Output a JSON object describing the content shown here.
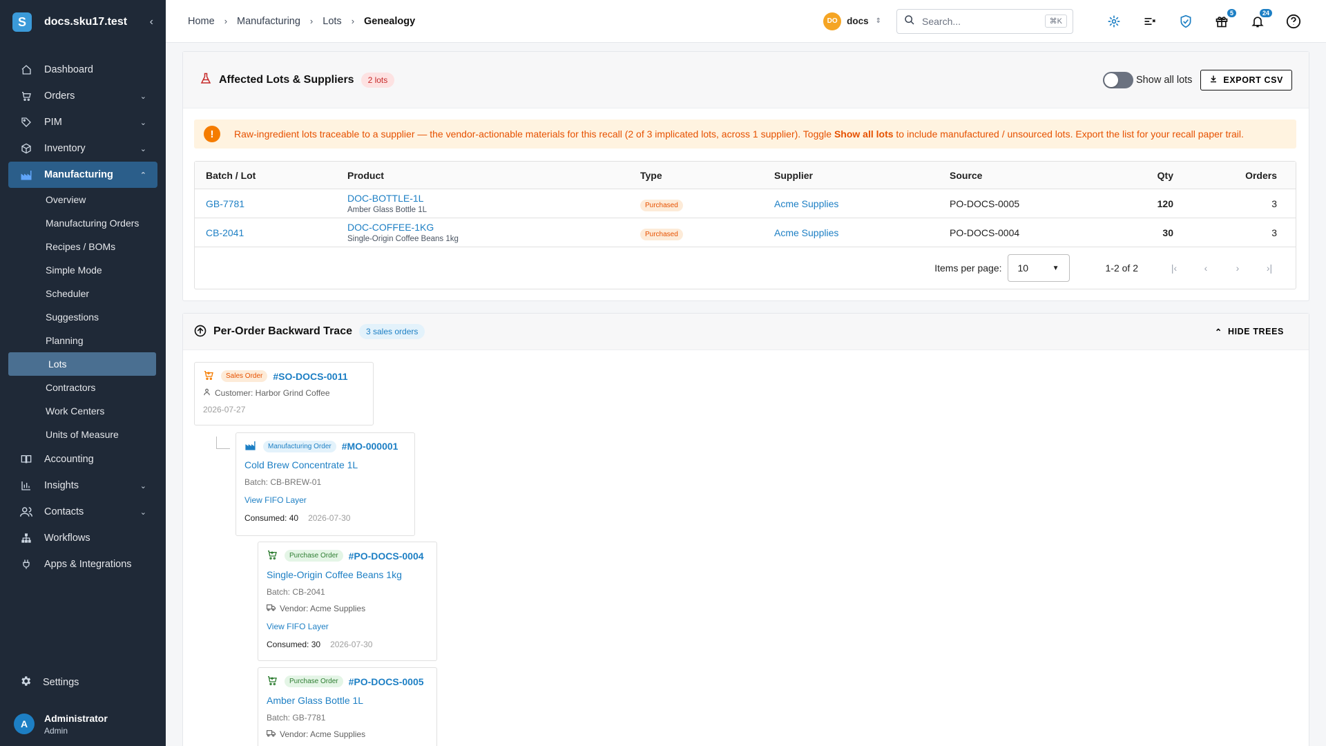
{
  "app": {
    "workspace": "docs.sku17.test",
    "logo_letter": "S"
  },
  "nav": {
    "items": [
      {
        "label": "Dashboard",
        "icon": "home-icon"
      },
      {
        "label": "Orders",
        "icon": "cart-icon",
        "expandable": true
      },
      {
        "label": "PIM",
        "icon": "tag-icon",
        "expandable": true
      },
      {
        "label": "Inventory",
        "icon": "box-icon",
        "expandable": true
      },
      {
        "label": "Manufacturing",
        "icon": "factory-icon",
        "expandable": true,
        "active": true
      }
    ],
    "manufacturing_sub": [
      "Overview",
      "Manufacturing Orders",
      "Recipes / BOMs",
      "Simple Mode",
      "Scheduler",
      "Suggestions",
      "Planning",
      "Lots",
      "Contractors",
      "Work Centers",
      "Units of Measure"
    ],
    "active_sub": "Lots",
    "items_after": [
      {
        "label": "Accounting",
        "icon": "book-icon"
      },
      {
        "label": "Insights",
        "icon": "chart-icon",
        "expandable": true
      },
      {
        "label": "Contacts",
        "icon": "contacts-icon",
        "expandable": true
      },
      {
        "label": "Workflows",
        "icon": "workflow-icon"
      },
      {
        "label": "Apps & Integrations",
        "icon": "plug-icon"
      }
    ],
    "settings": "Settings",
    "user": {
      "initial": "A",
      "name": "Administrator",
      "role": "Admin"
    }
  },
  "topbar": {
    "breadcrumbs": [
      "Home",
      "Manufacturing",
      "Lots",
      "Genealogy"
    ],
    "org_initials": "DO",
    "org_name": "docs",
    "search_placeholder": "Search...",
    "search_shortcut": "⌘K",
    "gift_badge": "5",
    "notif_badge": "24"
  },
  "affected": {
    "title": "Affected Lots & Suppliers",
    "count_pill": "2 lots",
    "toggle_label": "Show all lots",
    "export_label": "EXPORT CSV",
    "alert_pre": "Raw-ingredient lots traceable to a supplier — the vendor-actionable materials for this recall (2 of 3 implicated lots, across 1 supplier). Toggle ",
    "alert_bold": "Show all lots",
    "alert_post": " to include manufactured / unsourced lots. Export the list for your recall paper trail.",
    "columns": [
      "Batch / Lot",
      "Product",
      "Type",
      "Supplier",
      "Source",
      "Qty",
      "Orders"
    ],
    "rows": [
      {
        "lot": "GB-7781",
        "code": "DOC-BOTTLE-1L",
        "name": "Amber Glass Bottle 1L",
        "type": "Purchased",
        "supplier": "Acme Supplies",
        "source": "PO-DOCS-0005",
        "qty": "120",
        "orders": "3"
      },
      {
        "lot": "CB-2041",
        "code": "DOC-COFFEE-1KG",
        "name": "Single-Origin Coffee Beans 1kg",
        "type": "Purchased",
        "supplier": "Acme Supplies",
        "source": "PO-DOCS-0004",
        "qty": "30",
        "orders": "3"
      }
    ],
    "items_per_page_label": "Items per page:",
    "items_per_page": "10",
    "range": "1-2 of 2"
  },
  "trace": {
    "title": "Per-Order Backward Trace",
    "count_pill": "3 sales orders",
    "hide_label": "HIDE TREES",
    "sales": {
      "tag": "Sales Order",
      "id": "#SO-DOCS-0011",
      "customer": "Customer: Harbor Grind Coffee",
      "date": "2026-07-27"
    },
    "mo": {
      "tag": "Manufacturing Order",
      "id": "#MO-000001",
      "title": "Cold Brew Concentrate 1L",
      "batch": "Batch: CB-BREW-01",
      "link": "View FIFO Layer",
      "consumed_label": "Consumed:",
      "consumed": "40",
      "date": "2026-07-30"
    },
    "po1": {
      "tag": "Purchase Order",
      "id": "#PO-DOCS-0004",
      "title": "Single-Origin Coffee Beans 1kg",
      "batch": "Batch: CB-2041",
      "vendor": "Vendor: Acme Supplies",
      "link": "View FIFO Layer",
      "consumed_label": "Consumed:",
      "consumed": "30",
      "date": "2026-07-30"
    },
    "po2": {
      "tag": "Purchase Order",
      "id": "#PO-DOCS-0005",
      "title": "Amber Glass Bottle 1L",
      "batch": "Batch: GB-7781",
      "vendor": "Vendor: Acme Supplies"
    }
  }
}
